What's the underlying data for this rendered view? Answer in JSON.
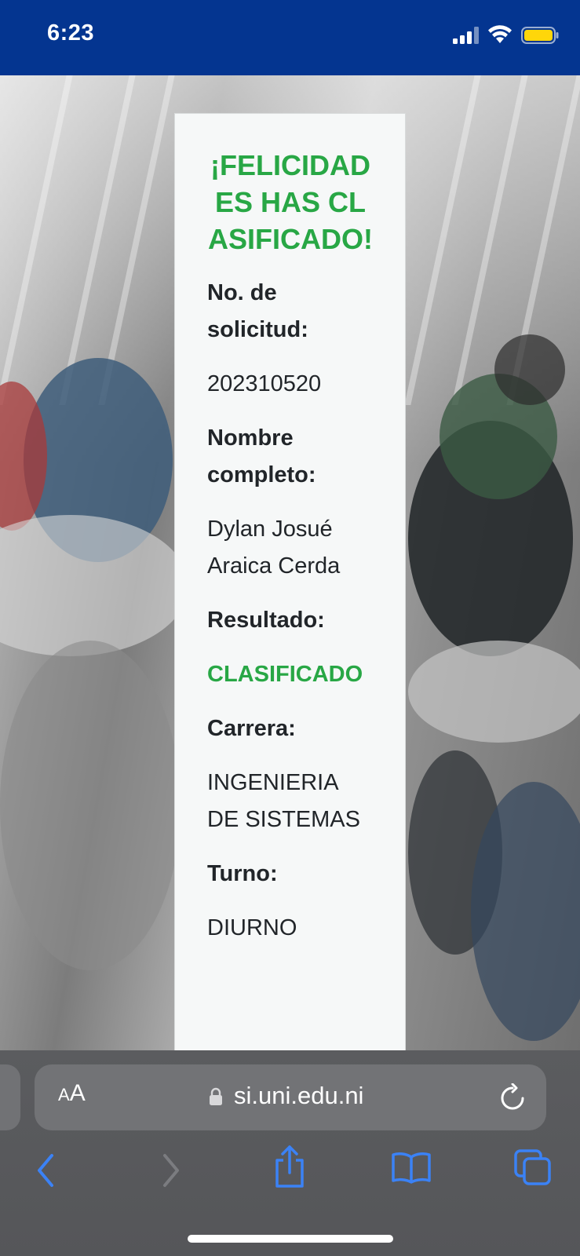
{
  "status_bar": {
    "time": "6:23",
    "icons": [
      "signal-icon",
      "wifi-icon",
      "battery-icon"
    ]
  },
  "card": {
    "headline": "¡FELICIDADES HAS CLASIFICADO!",
    "fields": [
      {
        "label": "No. de solicitud:",
        "value": "202310520"
      },
      {
        "label": "Nombre completo:",
        "value": "Dylan Josué Araica Cerda"
      },
      {
        "label": "Resultado:",
        "value": "CLASIFICADO"
      },
      {
        "label": "Carrera:",
        "value": "INGENIERIA DE SISTEMAS"
      },
      {
        "label": "Turno:",
        "value": "DIURNO"
      }
    ]
  },
  "browser": {
    "aa_label_small": "A",
    "aa_label_large": "A",
    "url": "si.uni.edu.ni",
    "toolbar_icons": [
      "back-icon",
      "forward-icon",
      "share-icon",
      "bookmarks-icon",
      "tabs-icon"
    ]
  },
  "colors": {
    "status_bar": "#043590",
    "accent_green": "#28a745",
    "text": "#212529",
    "ios_blue": "#3b82f6"
  }
}
